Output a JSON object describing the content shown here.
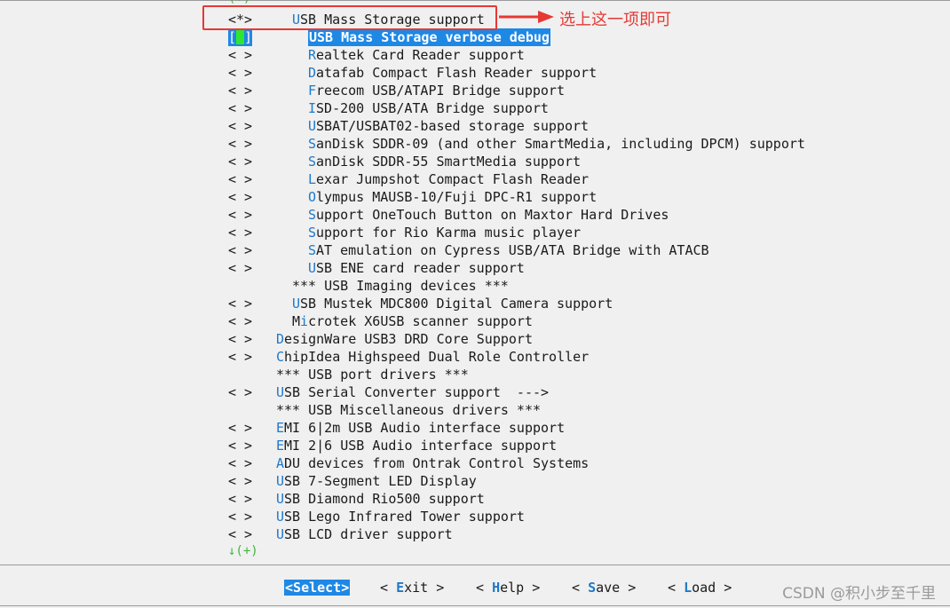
{
  "scroll_up": "(+)",
  "scroll_down": "↓(+)",
  "annotation": {
    "text": "选上这一项即可",
    "color": "#e53935"
  },
  "colors": {
    "hotkey": "#1e78c8",
    "highlight": "#1e88e5",
    "cursor": "#2ee62e",
    "scroll": "#3cb83c"
  },
  "menu": [
    {
      "mark": "<*>",
      "indent": 2,
      "hot": "U",
      "rest": "SB Mass Storage support"
    },
    {
      "mark": "[ ]",
      "indent": 3,
      "hot": "U",
      "rest": "SB Mass Storage verbose debug",
      "selected": true
    },
    {
      "mark": "< >",
      "indent": 3,
      "hot": "R",
      "rest": "ealtek Card Reader support"
    },
    {
      "mark": "< >",
      "indent": 3,
      "hot": "D",
      "rest": "atafab Compact Flash Reader support"
    },
    {
      "mark": "< >",
      "indent": 3,
      "hot": "F",
      "rest": "reecom USB/ATAPI Bridge support"
    },
    {
      "mark": "< >",
      "indent": 3,
      "hot": "I",
      "rest": "SD-200 USB/ATA Bridge support"
    },
    {
      "mark": "< >",
      "indent": 3,
      "hot": "U",
      "rest": "SBAT/USBAT02-based storage support"
    },
    {
      "mark": "< >",
      "indent": 3,
      "hot": "S",
      "rest": "anDisk SDDR-09 (and other SmartMedia, including DPCM) support"
    },
    {
      "mark": "< >",
      "indent": 3,
      "hot": "S",
      "rest": "anDisk SDDR-55 SmartMedia support"
    },
    {
      "mark": "< >",
      "indent": 3,
      "hot": "L",
      "rest": "exar Jumpshot Compact Flash Reader"
    },
    {
      "mark": "< >",
      "indent": 3,
      "hot": "O",
      "rest": "lympus MAUSB-10/Fuji DPC-R1 support"
    },
    {
      "mark": "< >",
      "indent": 3,
      "hot": "S",
      "rest": "upport OneTouch Button on Maxtor Hard Drives"
    },
    {
      "mark": "< >",
      "indent": 3,
      "hot": "S",
      "rest": "upport for Rio Karma music player"
    },
    {
      "mark": "< >",
      "indent": 3,
      "hot": "S",
      "rest": "AT emulation on Cypress USB/ATA Bridge with ATACB"
    },
    {
      "mark": "< >",
      "indent": 3,
      "hot": "U",
      "rest": "SB ENE card reader support"
    },
    {
      "mark": "",
      "indent": 2,
      "hot": "",
      "rest": "*** USB Imaging devices ***"
    },
    {
      "mark": "< >",
      "indent": 2,
      "hot": "U",
      "rest": "SB Mustek MDC800 Digital Camera support"
    },
    {
      "mark": "< >",
      "indent": 2,
      "pre": "M",
      "hot": "i",
      "rest": "crotek X6USB scanner support"
    },
    {
      "mark": "< >",
      "indent": 1,
      "hot": "D",
      "rest": "esignWare USB3 DRD Core Support"
    },
    {
      "mark": "< >",
      "indent": 1,
      "hot": "C",
      "rest": "hipIdea Highspeed Dual Role Controller"
    },
    {
      "mark": "",
      "indent": 1,
      "hot": "",
      "rest": "*** USB port drivers ***"
    },
    {
      "mark": "< >",
      "indent": 1,
      "hot": "U",
      "rest": "SB Serial Converter support  --->"
    },
    {
      "mark": "",
      "indent": 1,
      "hot": "",
      "rest": "*** USB Miscellaneous drivers ***"
    },
    {
      "mark": "< >",
      "indent": 1,
      "hot": "E",
      "rest": "MI 6|2m USB Audio interface support"
    },
    {
      "mark": "< >",
      "indent": 1,
      "hot": "E",
      "rest": "MI 2|6 USB Audio interface support"
    },
    {
      "mark": "< >",
      "indent": 1,
      "hot": "A",
      "rest": "DU devices from Ontrak Control Systems"
    },
    {
      "mark": "< >",
      "indent": 1,
      "hot": "U",
      "rest": "SB 7-Segment LED Display"
    },
    {
      "mark": "< >",
      "indent": 1,
      "hot": "U",
      "rest": "SB Diamond Rio500 support"
    },
    {
      "mark": "< >",
      "indent": 1,
      "hot": "U",
      "rest": "SB Lego Infrared Tower support"
    },
    {
      "mark": "< >",
      "indent": 1,
      "hot": "U",
      "rest": "SB LCD driver support"
    }
  ],
  "buttons": [
    {
      "open": "<",
      "key": "S",
      "rest": "elect",
      "close": ">",
      "active": true
    },
    {
      "open": "< ",
      "key": "E",
      "rest": "xit",
      "close": " >"
    },
    {
      "open": "< ",
      "key": "H",
      "rest": "elp",
      "close": " >"
    },
    {
      "open": "< ",
      "key": "S",
      "rest": "ave",
      "close": " >"
    },
    {
      "open": "< ",
      "key": "L",
      "rest": "oad",
      "close": " >"
    }
  ],
  "watermark": "CSDN @积小步至千里"
}
